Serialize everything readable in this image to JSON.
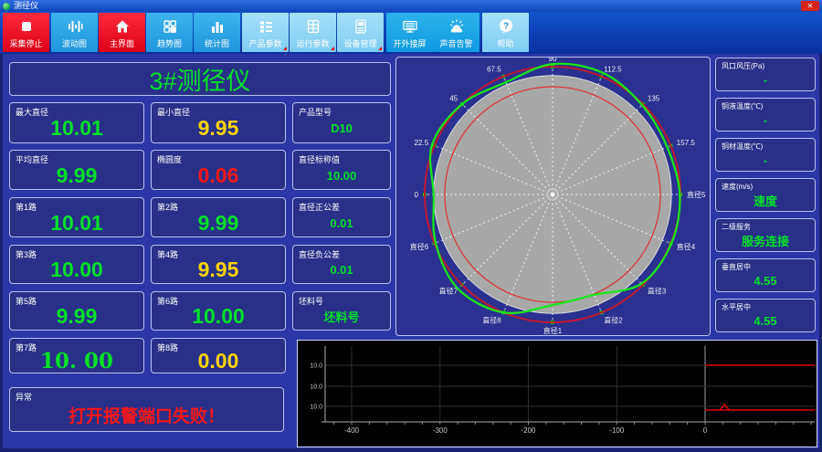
{
  "window": {
    "title": "测径仪",
    "close_glyph": "✕"
  },
  "colors": {
    "green": "#00e12a",
    "yellow": "#ffd400",
    "red": "#ff1616",
    "profile_green": "#1ae61a",
    "tolerance_red": "#c01830",
    "trace_red": "#e00000"
  },
  "toolbar": {
    "buttons": [
      {
        "label": "采集停止",
        "icon": "stop-icon",
        "color": "red"
      },
      {
        "label": "波动图",
        "icon": "waveform-icon",
        "color": "blue"
      },
      {
        "label": "主界面",
        "icon": "home-icon",
        "color": "red"
      },
      {
        "label": "趋势图",
        "icon": "grid4-icon",
        "color": "blue"
      },
      {
        "label": "统计图",
        "icon": "barchart-icon",
        "color": "blue"
      },
      {
        "label": "产品参数",
        "icon": "list-icon",
        "color": "lightblue",
        "dropdown": true
      },
      {
        "label": "运行参数",
        "icon": "table-icon",
        "color": "lightblue",
        "dropdown": true
      },
      {
        "label": "设备管理",
        "icon": "device-icon",
        "color": "lightblue",
        "dropdown": true
      },
      {
        "label": "开外接屏",
        "icon": "monitor-icon",
        "color": "cyan"
      },
      {
        "label": "声音告警",
        "icon": "siren-icon",
        "color": "cyan"
      },
      {
        "label": "帮助",
        "icon": "help-icon",
        "color": "lightblue"
      }
    ]
  },
  "left_panel": {
    "title": "3#测径仪",
    "rows": [
      [
        {
          "label": "最大直径",
          "value": "10.01",
          "color": "green"
        },
        {
          "label": "最小直径",
          "value": "9.95",
          "color": "yellow"
        },
        {
          "label": "产品型号",
          "value": "D10",
          "color": "green"
        }
      ],
      [
        {
          "label": "平均直径",
          "value": "9.99",
          "color": "green"
        },
        {
          "label": "椭圆度",
          "value": "0.06",
          "color": "red"
        },
        {
          "label": "直径标称值",
          "value": "10.00",
          "color": "green"
        }
      ],
      [
        {
          "label": "第1路",
          "value": "10.01",
          "color": "green"
        },
        {
          "label": "第2路",
          "value": "9.99",
          "color": "green"
        },
        {
          "label": "直径正公差",
          "value": "0.01",
          "color": "green"
        }
      ],
      [
        {
          "label": "第3路",
          "value": "10.00",
          "color": "green"
        },
        {
          "label": "第4路",
          "value": "9.95",
          "color": "yellow"
        },
        {
          "label": "直径负公差",
          "value": "0.01",
          "color": "green"
        }
      ],
      [
        {
          "label": "第5路",
          "value": "9.99",
          "color": "green"
        },
        {
          "label": "第6路",
          "value": "10.00",
          "color": "green"
        },
        {
          "label": "坯料号",
          "value": "坯料号",
          "color": "green"
        }
      ],
      [
        {
          "label": "第7路",
          "value": "10. 00",
          "color": "green",
          "serif": true
        },
        {
          "label": "第8路",
          "value": "0.00",
          "color": "yellow"
        },
        null
      ]
    ],
    "error_cell": {
      "label": "异常",
      "value": "打开报警端口失败！",
      "color": "red"
    }
  },
  "right_panel": {
    "cells": [
      {
        "label": "风口风压(Pa)",
        "value": "-",
        "color": "green"
      },
      {
        "label": "铜液温度(℃)",
        "value": "-",
        "color": "green"
      },
      {
        "label": "铜材温度(℃)",
        "value": "-",
        "color": "green"
      },
      {
        "label": "速度(m/s)",
        "value": "速度",
        "color": "green",
        "big": true
      },
      {
        "label": "二级服务",
        "value": "服务连接",
        "color": "green",
        "big": true
      },
      {
        "label": "垂直居中",
        "value": "4.55",
        "color": "green",
        "big": true
      },
      {
        "label": "水平居中",
        "value": "4.55",
        "color": "green",
        "big": true
      }
    ]
  },
  "chart_data": [
    {
      "type": "polar-profile",
      "name": "roundness-profile",
      "spoke_labels": [
        "0",
        "22.5",
        "45",
        "67.5",
        "90",
        "112.5",
        "135",
        "157.5",
        "直径5",
        "直径4",
        "直径3",
        "直径2",
        "直径1",
        "直径8",
        "直径7",
        "直径6"
      ],
      "spoke_angles_deg": [
        180,
        157.5,
        135,
        112.5,
        90,
        67.5,
        45,
        22.5,
        0,
        -22.5,
        -45,
        -67.5,
        -90,
        -112.5,
        -135,
        -157.5
      ],
      "profile_angles_deg": [
        0,
        22.5,
        45,
        67.5,
        90,
        112.5,
        135,
        157.5,
        180,
        202.5,
        225,
        247.5,
        270,
        292.5,
        315,
        337.5
      ],
      "profile_radius_factor": [
        0.995,
        0.97,
        0.99,
        1.03,
        1.02,
        0.95,
        1.0,
        1.02,
        0.93,
        0.99,
        1.045,
        1.0,
        0.865,
        0.85,
        0.985,
        1.005
      ],
      "rings": {
        "nominal_gray": 0.93,
        "tolerance_outer": 1.0,
        "tolerance_inner": 0.843
      }
    },
    {
      "type": "line",
      "name": "diameter-trend",
      "x_range": [
        -450,
        124
      ],
      "x_ticks": [
        "-400",
        "-300",
        "-200",
        "-100",
        "0"
      ],
      "x_tick_values": [
        -400,
        -300,
        -200,
        -100,
        0
      ],
      "y_gridline_labels": [
        "10.0",
        "10.0",
        "10.0"
      ],
      "series": [
        {
          "name": "upper-trace",
          "x0": 0,
          "x1": 124,
          "gridline": 0,
          "offset": 0
        },
        {
          "name": "lower-trace",
          "x0": 0,
          "x1": 124,
          "gridline": 2,
          "offset": 4,
          "spike_x": 22,
          "spike_h": 6
        }
      ]
    }
  ]
}
